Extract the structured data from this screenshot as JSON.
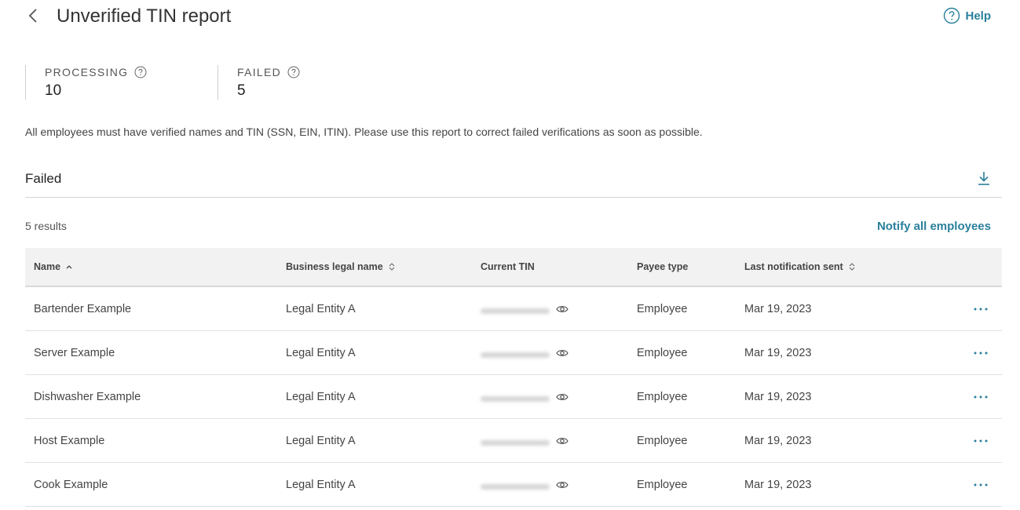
{
  "header": {
    "title": "Unverified TIN report",
    "help_label": "Help"
  },
  "stats": [
    {
      "label": "PROCESSING",
      "value": "10"
    },
    {
      "label": "FAILED",
      "value": "5"
    }
  ],
  "description": "All employees must have verified names and TIN (SSN, EIN, ITIN). Please use this report to correct failed verifications as soon as possible.",
  "section": {
    "title": "Failed"
  },
  "results": {
    "count": "5 results",
    "notify_label": "Notify all employees"
  },
  "table": {
    "columns": [
      "Name",
      "Business legal name",
      "Current TIN",
      "Payee type",
      "Last notification sent"
    ],
    "rows": [
      {
        "name": "Bartender Example",
        "business": "Legal Entity A",
        "payee": "Employee",
        "last_sent": "Mar 19, 2023"
      },
      {
        "name": "Server Example",
        "business": "Legal Entity A",
        "payee": "Employee",
        "last_sent": "Mar 19, 2023"
      },
      {
        "name": "Dishwasher Example",
        "business": "Legal Entity A",
        "payee": "Employee",
        "last_sent": "Mar 19, 2023"
      },
      {
        "name": "Host Example",
        "business": "Legal Entity A",
        "payee": "Employee",
        "last_sent": "Mar 19, 2023"
      },
      {
        "name": "Cook Example",
        "business": "Legal Entity A",
        "payee": "Employee",
        "last_sent": "Mar 19, 2023"
      }
    ]
  },
  "colors": {
    "accent": "#2a7f9c"
  }
}
